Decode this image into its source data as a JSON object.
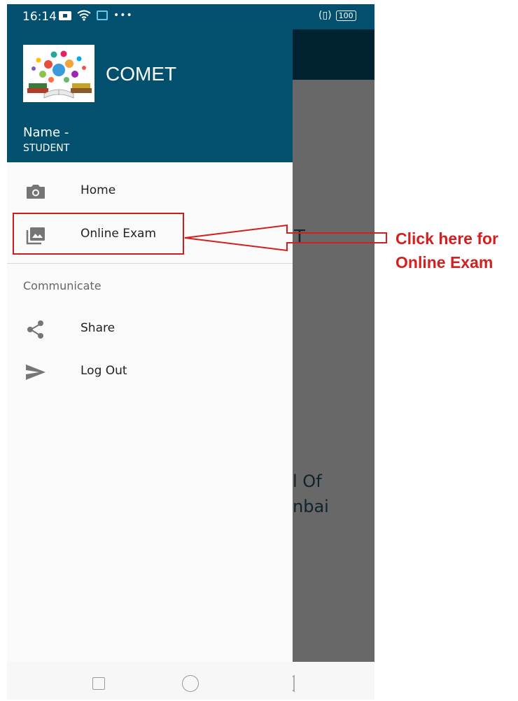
{
  "status_bar": {
    "time": "16:14",
    "battery": "100",
    "icons": [
      "notification-icon",
      "wifi-icon",
      "app-notification-icon",
      "more-dots-icon",
      "vibrate-icon",
      "battery-icon"
    ]
  },
  "drawer": {
    "header": {
      "app_title": "COMET",
      "user_name": "Name -",
      "user_role": "STUDENT",
      "header_color": "#02506e"
    },
    "items": [
      {
        "label": "Home",
        "icon": "camera-icon"
      },
      {
        "label": "Online Exam",
        "icon": "photo-library-icon"
      }
    ],
    "section_title": "Communicate",
    "communicate_items": [
      {
        "label": "Share",
        "icon": "share-icon"
      },
      {
        "label": "Log Out",
        "icon": "send-icon"
      }
    ]
  },
  "background_app": {
    "text_fragments": [
      "T",
      "l Of",
      "nbai"
    ]
  },
  "annotation": {
    "line1": "Click here for",
    "line2": "Online Exam",
    "color": "#d41f1f"
  }
}
